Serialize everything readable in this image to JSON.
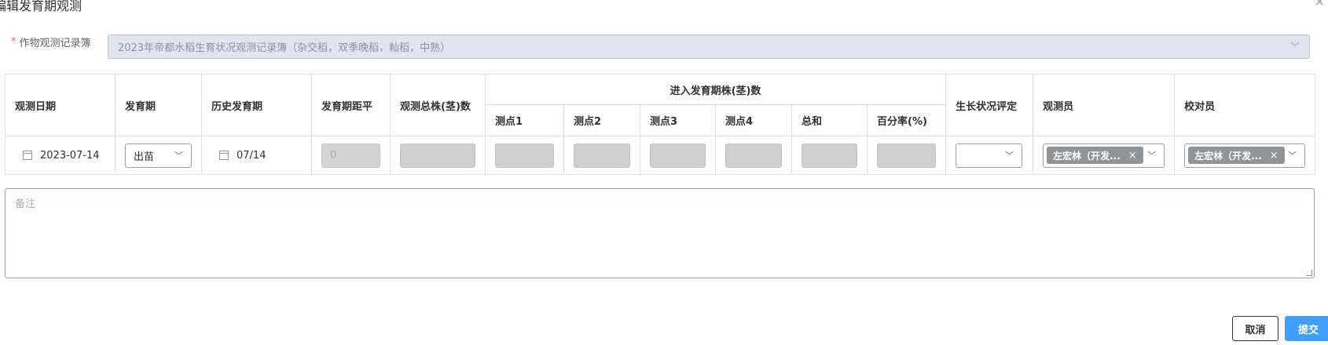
{
  "dialog": {
    "title": "编辑发育期观测",
    "close_glyph": "×"
  },
  "form": {
    "required_mark": "*",
    "book_label": "作物观测记录簿",
    "book_value": "2023年帝都水稻生育状况观测记录簿（杂交稻，双季晚稻，籼稻，中熟）"
  },
  "table": {
    "headers": {
      "obs_date": "观测日期",
      "stage": "发育期",
      "hist_stage": "历史发育期",
      "stage_dist": "发育期距平",
      "total_plants": "观测总株(茎)数",
      "entered_group": "进入发育期株(茎)数",
      "point1": "测点1",
      "point2": "测点2",
      "point3": "测点3",
      "point4": "测点4",
      "sum": "总和",
      "percent": "百分率(%)",
      "growth_eval": "生长状况评定",
      "observer": "观测员",
      "checker": "校对员"
    },
    "row": {
      "obs_date": "2023-07-14",
      "stage": "出苗",
      "hist_stage": "07/14",
      "stage_dist": "0",
      "observer_tag": "左宏林（开发...",
      "checker_tag": "左宏林（开发..."
    }
  },
  "remark": {
    "placeholder": "备注"
  },
  "buttons": {
    "cancel": "取消",
    "submit": "提交"
  }
}
